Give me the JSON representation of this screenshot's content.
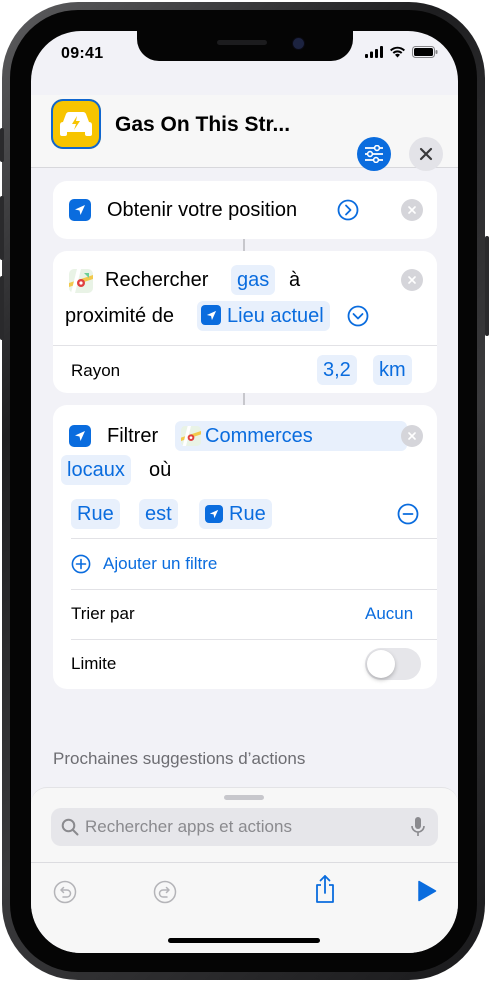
{
  "status": {
    "time": "09:41"
  },
  "shortcut": {
    "title": "Gas On This Str..."
  },
  "action1": {
    "label": "Obtenir votre position"
  },
  "action2": {
    "word1": "Rechercher",
    "query": "gas",
    "word2": "à",
    "word3": "proximité de",
    "location": "Lieu actuel",
    "radius_label": "Rayon",
    "radius_value": "3,2",
    "radius_unit": "km"
  },
  "action3": {
    "word1": "Filtrer",
    "source_line1": "Commerces",
    "source_line2": "locaux",
    "word2": "où",
    "filter_field": "Rue",
    "filter_operator": "est",
    "filter_value": "Rue",
    "add_filter": "Ajouter un filtre",
    "sort_label": "Trier par",
    "sort_value": "Aucun",
    "limit_label": "Limite",
    "limit_enabled": false
  },
  "suggestions": {
    "title": "Prochaines suggestions d’actions"
  },
  "search": {
    "placeholder": "Rechercher apps et actions"
  },
  "colors": {
    "accent": "#0a6cde",
    "icon_bg": "#f7c400"
  }
}
